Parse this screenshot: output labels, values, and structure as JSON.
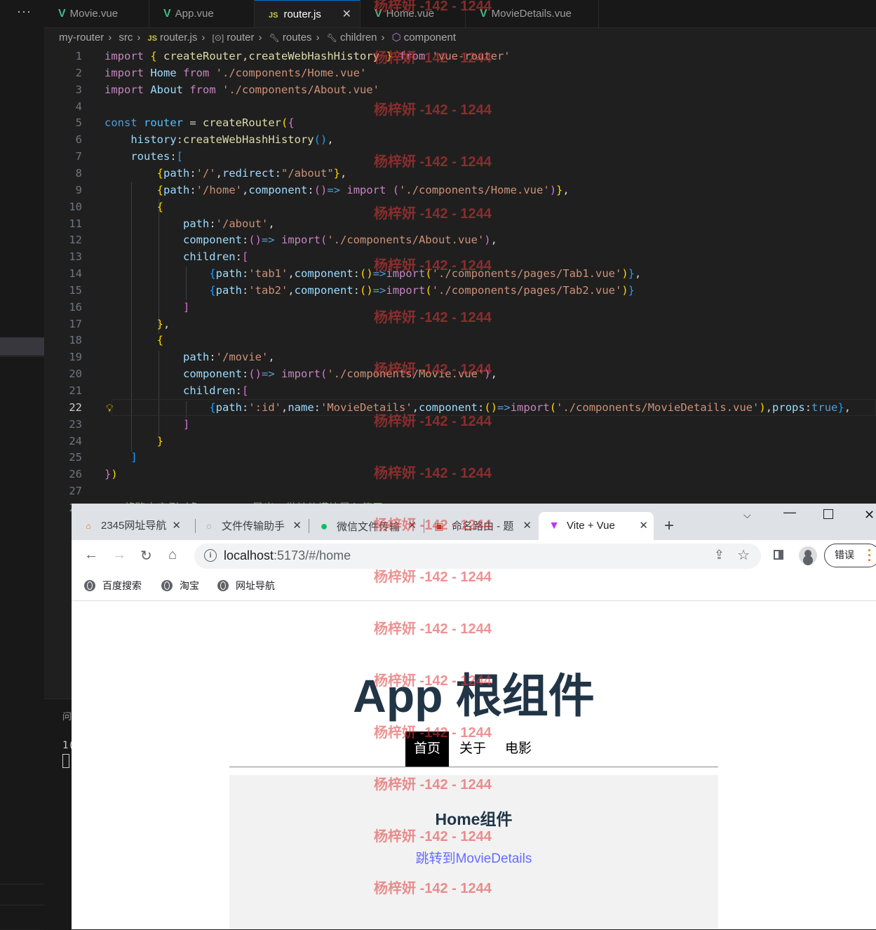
{
  "vscode": {
    "overflow_menu": "···",
    "tabs": [
      {
        "label": "Movie.vue",
        "icon": "vue-icon"
      },
      {
        "label": "App.vue",
        "icon": "vue-icon"
      },
      {
        "label": "router.js",
        "icon": "js-icon",
        "active": true
      },
      {
        "label": "Home.vue",
        "icon": "vue-icon"
      },
      {
        "label": "MovieDetails.vue",
        "icon": "vue-icon"
      }
    ],
    "close_glyph": "✕",
    "breadcrumb": [
      "my-router",
      "src",
      "router.js",
      "router",
      "routes",
      "children",
      "component"
    ],
    "current_line": 22,
    "panel_tab": "问",
    "panel_number": "1("
  },
  "browser": {
    "tabs": [
      {
        "label": "2345网址导航"
      },
      {
        "label": "文件传输助手"
      },
      {
        "label": "微信文件传输"
      },
      {
        "label": "命名路由 - 题"
      },
      {
        "label": "Vite + Vue",
        "active": true
      }
    ],
    "new_tab": "+",
    "url_host": "localhost",
    "url_rest": ":5173/#/home",
    "error_button": "错误",
    "bookmarks": [
      "百度搜索",
      "淘宝",
      "网址导航"
    ]
  },
  "page": {
    "title": "App 根组件",
    "nav": [
      "首页",
      "关于",
      "电影"
    ],
    "active_nav": "首页",
    "home_heading": "Home组件",
    "home_link": "跳转到MovieDetails"
  },
  "watermark": "杨梓妍 -142 - 1244",
  "colors": {
    "accent": "#0078d4",
    "vue_green": "#41b883",
    "link": "#646cff",
    "title": "#213547"
  }
}
